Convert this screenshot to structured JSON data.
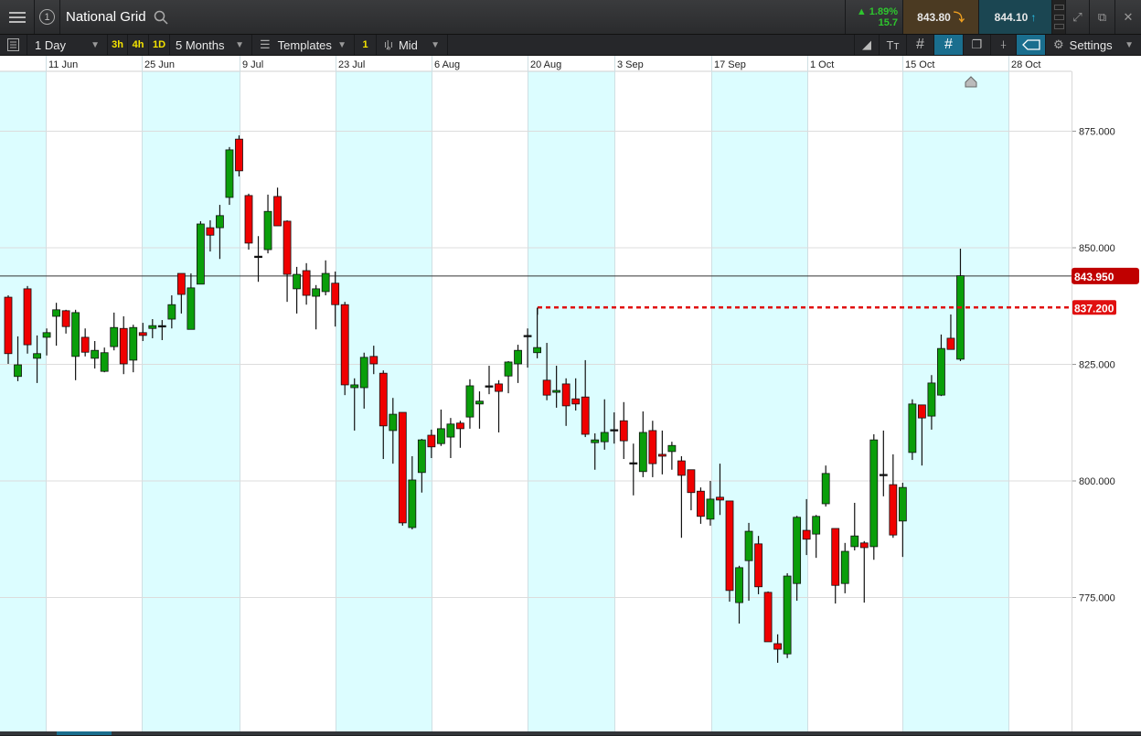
{
  "header": {
    "title": "National Grid",
    "badge": "1",
    "change_pct": "1.89%",
    "change_abs": "15.7",
    "sell_price": "843.80",
    "buy_price": "844.10"
  },
  "toolbar": {
    "interval": "1 Day",
    "quick_3h": "3h",
    "quick_4h": "4h",
    "quick_1d": "1D",
    "range": "5 Months",
    "templates": "Templates",
    "templates_count": "1",
    "price_type": "Mid",
    "settings": "Settings"
  },
  "colors": {
    "up": "#0a9e0a",
    "down": "#f00000",
    "band": "#dcfdff",
    "sell_bg": "#4b3a22",
    "buy_bg": "#1b4652",
    "accent": "#1a6e8e"
  },
  "chart_data": {
    "type": "candlestick",
    "title": "National Grid",
    "interval": "1 Day",
    "x_tick_labels": [
      "11 Jun",
      "25 Jun",
      "9 Jul",
      "23 Jul",
      "6 Aug",
      "20 Aug",
      "3 Sep",
      "17 Sep",
      "1 Oct",
      "15 Oct",
      "28 Oct"
    ],
    "y_ticks": [
      "875.000",
      "850.000",
      "825.000",
      "800.000",
      "775.000"
    ],
    "y_tick_values": [
      875,
      850,
      825,
      800,
      775
    ],
    "current_price": 843.95,
    "current_price_label": "843.950",
    "order_level": 837.2,
    "order_level_label": "837.200",
    "ohlc": [
      [
        839.4,
        839.8,
        825.1,
        827.3
      ],
      [
        822.4,
        831.0,
        821.4,
        824.9
      ],
      [
        841.2,
        841.8,
        827.3,
        829.2
      ],
      [
        826.3,
        831.2,
        821.0,
        827.3
      ],
      [
        830.8,
        832.7,
        826.9,
        831.8
      ],
      [
        835.3,
        838.2,
        829.0,
        836.7
      ],
      [
        836.5,
        836.7,
        831.6,
        833.1
      ],
      [
        826.7,
        836.7,
        821.6,
        836.1
      ],
      [
        830.8,
        832.7,
        826.7,
        827.6
      ],
      [
        826.3,
        830.0,
        824.1,
        828.0
      ],
      [
        823.5,
        828.6,
        823.3,
        827.5
      ],
      [
        828.8,
        836.1,
        828.0,
        832.9
      ],
      [
        832.7,
        835.3,
        822.9,
        825.1
      ],
      [
        825.9,
        833.5,
        823.3,
        832.9
      ],
      [
        831.8,
        833.9,
        830.0,
        831.2
      ],
      [
        832.7,
        834.7,
        830.6,
        833.3
      ],
      [
        833.3,
        834.5,
        830.2,
        833.3
      ],
      [
        834.7,
        839.8,
        832.7,
        837.8
      ],
      [
        844.5,
        844.5,
        835.9,
        840.0
      ],
      [
        832.5,
        844.5,
        832.5,
        841.4
      ],
      [
        842.2,
        855.7,
        842.2,
        855.1
      ],
      [
        854.3,
        855.9,
        849.2,
        852.7
      ],
      [
        854.3,
        859.2,
        847.6,
        856.9
      ],
      [
        860.8,
        871.6,
        859.2,
        871.0
      ],
      [
        873.3,
        874.1,
        865.3,
        866.5
      ],
      [
        861.2,
        861.6,
        849.6,
        851.0
      ],
      [
        848.2,
        852.5,
        842.7,
        848.2
      ],
      [
        849.6,
        861.4,
        848.8,
        857.8
      ],
      [
        861.0,
        862.9,
        854.7,
        854.7
      ],
      [
        855.7,
        855.9,
        838.4,
        844.3
      ],
      [
        841.2,
        845.9,
        835.9,
        844.3
      ],
      [
        845.1,
        846.7,
        837.8,
        839.8
      ],
      [
        839.6,
        842.0,
        832.5,
        841.2
      ],
      [
        840.6,
        847.3,
        839.8,
        844.5
      ],
      [
        842.4,
        844.9,
        833.1,
        837.8
      ],
      [
        837.8,
        838.4,
        818.4,
        820.6
      ],
      [
        820.0,
        822.0,
        810.8,
        820.6
      ],
      [
        820.0,
        827.5,
        815.5,
        826.5
      ],
      [
        826.7,
        829.0,
        822.9,
        825.1
      ],
      [
        823.1,
        823.7,
        804.7,
        811.8
      ],
      [
        810.8,
        817.8,
        803.7,
        814.3
      ],
      [
        814.7,
        814.7,
        790.4,
        791.0
      ],
      [
        790.0,
        805.3,
        789.6,
        800.2
      ],
      [
        801.8,
        809.0,
        797.5,
        808.8
      ],
      [
        809.8,
        811.0,
        804.9,
        807.3
      ],
      [
        808.0,
        815.3,
        807.5,
        811.2
      ],
      [
        809.4,
        813.5,
        804.9,
        812.2
      ],
      [
        812.4,
        812.9,
        807.1,
        811.2
      ],
      [
        813.7,
        821.8,
        811.2,
        820.4
      ],
      [
        816.5,
        819.2,
        811.2,
        817.1
      ],
      [
        820.4,
        824.7,
        818.6,
        820.4
      ],
      [
        820.8,
        821.6,
        810.4,
        819.2
      ],
      [
        822.5,
        825.7,
        818.8,
        825.5
      ],
      [
        825.1,
        829.2,
        821.0,
        828.0
      ],
      [
        831.2,
        832.7,
        824.3,
        831.2
      ],
      [
        827.5,
        837.1,
        826.3,
        828.6
      ],
      [
        821.6,
        829.6,
        817.3,
        818.4
      ],
      [
        819.0,
        824.7,
        815.7,
        819.4
      ],
      [
        820.8,
        822.0,
        811.8,
        816.1
      ],
      [
        817.6,
        822.0,
        815.1,
        816.5
      ],
      [
        818.0,
        825.9,
        809.4,
        810.0
      ],
      [
        808.2,
        810.2,
        802.4,
        808.8
      ],
      [
        808.4,
        817.5,
        806.7,
        810.4
      ],
      [
        811.0,
        814.7,
        808.0,
        811.0
      ],
      [
        812.9,
        816.9,
        804.7,
        808.6
      ],
      [
        803.9,
        808.0,
        796.9,
        803.9
      ],
      [
        802.0,
        814.9,
        800.8,
        810.4
      ],
      [
        810.8,
        812.9,
        800.8,
        803.7
      ],
      [
        805.7,
        810.8,
        801.4,
        805.3
      ],
      [
        806.3,
        808.4,
        802.4,
        807.6
      ],
      [
        804.3,
        805.3,
        787.8,
        801.2
      ],
      [
        802.4,
        802.4,
        793.7,
        797.5
      ],
      [
        797.8,
        798.6,
        790.8,
        792.4
      ],
      [
        791.8,
        800.0,
        790.4,
        796.1
      ],
      [
        796.5,
        803.7,
        792.7,
        795.9
      ],
      [
        795.7,
        795.7,
        774.1,
        776.5
      ],
      [
        773.9,
        781.8,
        769.4,
        781.4
      ],
      [
        782.9,
        791.0,
        774.3,
        789.2
      ],
      [
        786.5,
        788.2,
        775.7,
        777.3
      ],
      [
        776.1,
        776.3,
        765.5,
        765.5
      ],
      [
        765.1,
        767.1,
        761.0,
        763.9
      ],
      [
        762.9,
        780.2,
        762.0,
        779.6
      ],
      [
        778.0,
        792.5,
        774.3,
        792.2
      ],
      [
        789.4,
        796.1,
        784.1,
        787.5
      ],
      [
        788.6,
        792.7,
        783.5,
        792.4
      ],
      [
        795.1,
        803.3,
        794.5,
        801.6
      ],
      [
        789.8,
        789.8,
        773.7,
        777.6
      ],
      [
        778.0,
        786.7,
        775.9,
        784.9
      ],
      [
        785.9,
        795.3,
        785.1,
        788.2
      ],
      [
        786.7,
        787.1,
        773.9,
        785.7
      ],
      [
        785.9,
        810.0,
        783.1,
        808.8
      ],
      [
        801.4,
        810.8,
        796.7,
        801.4
      ],
      [
        799.2,
        805.7,
        787.8,
        788.4
      ],
      [
        791.4,
        799.6,
        783.7,
        798.6
      ],
      [
        806.1,
        817.5,
        804.5,
        816.5
      ],
      [
        816.3,
        816.3,
        803.3,
        813.5
      ],
      [
        813.9,
        822.7,
        811.0,
        821.0
      ],
      [
        818.4,
        831.4,
        818.2,
        828.4
      ],
      [
        830.6,
        835.7,
        828.2,
        828.2
      ],
      [
        826.1,
        849.8,
        825.7,
        844.0
      ]
    ]
  }
}
